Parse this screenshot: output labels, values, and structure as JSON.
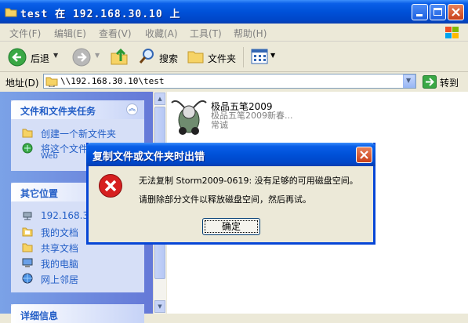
{
  "window": {
    "title": "test 在 192.168.30.10 上"
  },
  "menubar": {
    "items": [
      "文件(F)",
      "编辑(E)",
      "查看(V)",
      "收藏(A)",
      "工具(T)",
      "帮助(H)"
    ]
  },
  "toolbar": {
    "back_label": "后退",
    "search_label": "搜索",
    "folders_label": "文件夹"
  },
  "address": {
    "label": "地址(D)",
    "value": "\\\\192.168.30.10\\test",
    "go_label": "转到"
  },
  "left": {
    "tasks_title": "文件和文件夹任务",
    "tasks": [
      "创建一个新文件夹",
      "将这个文件",
      "Web"
    ],
    "places_title": "其它位置",
    "places": [
      "192.168.30...",
      "我的文档",
      "共享文档",
      "我的电脑",
      "网上邻居"
    ],
    "details_title": "详细信息"
  },
  "file": {
    "name": "极品五笔2009",
    "description": "极品五笔2009新春...",
    "publisher": "常诚"
  },
  "dialog": {
    "title": "复制文件或文件夹时出错",
    "message_line1": "无法复制 Storm2009-0619: 没有足够的可用磁盘空间。",
    "message_line2": "请删除部分文件以释放磁盘空间，然后再试。",
    "ok_label": "确定"
  },
  "colors": {
    "xp_blue": "#0051d8",
    "panel_link": "#215dc6",
    "error_red": "#d62020"
  },
  "icons": [
    "folder-icon",
    "back-arrow-icon",
    "forward-arrow-icon",
    "up-folder-icon",
    "search-icon",
    "views-icon",
    "go-arrow-icon",
    "error-icon",
    "close-icon",
    "windows-logo-icon"
  ]
}
